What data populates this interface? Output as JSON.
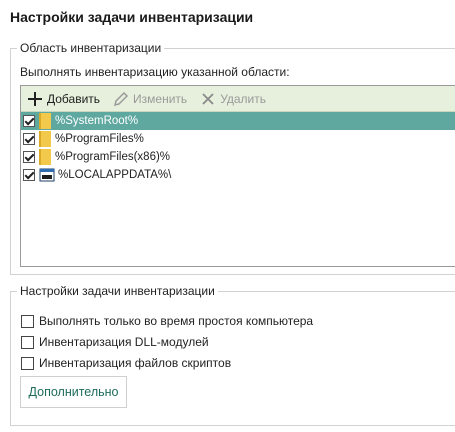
{
  "window": {
    "title": "Настройки задачи инвентаризации"
  },
  "scope_group": {
    "legend": "Область инвентаризации",
    "description": "Выполнять инвентаризацию указанной области:",
    "toolbar": {
      "add_label": "Добавить",
      "edit_label": "Изменить",
      "delete_label": "Удалить"
    },
    "items": [
      {
        "path": "%SystemRoot%",
        "checked": true,
        "selected": true,
        "icon": "folder-icon"
      },
      {
        "path": "%ProgramFiles%",
        "checked": true,
        "selected": false,
        "icon": "folder-icon"
      },
      {
        "path": "%ProgramFiles(x86)%",
        "checked": true,
        "selected": false,
        "icon": "folder-icon"
      },
      {
        "path": "%LOCALAPPDATA%\\",
        "checked": true,
        "selected": false,
        "icon": "drive-icon"
      }
    ]
  },
  "settings_group": {
    "legend": "Настройки задачи инвентаризации",
    "options": [
      {
        "label": "Выполнять только во время простоя компьютера",
        "checked": false
      },
      {
        "label": "Инвентаризация DLL-модулей",
        "checked": false
      },
      {
        "label": "Инвентаризация файлов скриптов",
        "checked": false
      }
    ],
    "more_button": "Дополнительно"
  },
  "colors": {
    "toolbar_bg": "#e6f0dc",
    "selection": "#5fa8a0",
    "accent_text": "#1e6b5c",
    "disabled_text": "#9a9a9a"
  }
}
